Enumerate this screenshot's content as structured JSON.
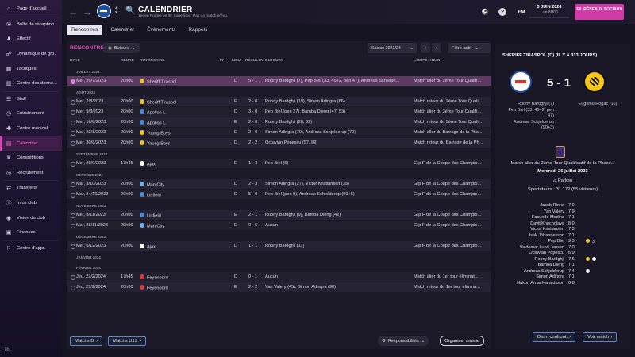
{
  "sidebar": {
    "items": [
      {
        "icon": "home-icon",
        "glyph": "⌂",
        "label": "Page d'accueil"
      },
      {
        "icon": "inbox-icon",
        "glyph": "✉",
        "label": "Boîte de réception"
      },
      {
        "icon": "squad-icon",
        "glyph": "♟",
        "label": "Effectif"
      },
      {
        "icon": "dynamics-icon",
        "glyph": "☍",
        "label": "Dynamique de grp."
      },
      {
        "icon": "tactics-icon",
        "glyph": "▦",
        "label": "Tactiques"
      },
      {
        "icon": "data-icon",
        "glyph": "▥",
        "label": "Centre des donné..."
      },
      {
        "icon": "staff-icon",
        "glyph": "☰",
        "label": "Staff"
      },
      {
        "icon": "training-icon",
        "glyph": "◷",
        "label": "Entraînement"
      },
      {
        "icon": "medical-icon",
        "glyph": "✚",
        "label": "Centre médical"
      },
      {
        "icon": "calendar-icon",
        "glyph": "▤",
        "label": "Calendrier"
      },
      {
        "icon": "competitions-icon",
        "glyph": "♛",
        "label": "Compétitions"
      },
      {
        "icon": "scouting-icon",
        "glyph": "◎",
        "label": "Recrutement"
      },
      {
        "icon": "transfers-icon",
        "glyph": "⇄",
        "label": "Transferts"
      },
      {
        "icon": "club-info-icon",
        "glyph": "ⓘ",
        "label": "Infos club"
      },
      {
        "icon": "club-vision-icon",
        "glyph": "◉",
        "label": "Vision du club"
      },
      {
        "icon": "finances-icon",
        "glyph": "▣",
        "label": "Finances"
      },
      {
        "icon": "dev-centre-icon",
        "glyph": "⚐",
        "label": "Centre d'appr."
      }
    ],
    "active_index": 9,
    "footer": "8b"
  },
  "topbar": {
    "title": "CALENDRIER",
    "subtitle": "1er en Poules de 3F Superliga · Pas de match prévu.",
    "date_line1": "3 JUIN 2024",
    "date_line2": "Lun 8H00",
    "social_label": "FIL RÉSEAUX SOCIAUX",
    "fm_label": "FM",
    "back_glyph": "←",
    "forward_glyph": "→",
    "search_glyph": "🔍",
    "help_glyph": "?",
    "fixture_icon_glyph": "⚽"
  },
  "tabs": [
    "Rencontres",
    "Calendrier",
    "Évènements",
    "Rappels"
  ],
  "main": {
    "section_title": "RENCONTRES",
    "filter_label": "Buteurs",
    "season": "Saison 2023/24",
    "filter_active": "Filtre actif",
    "headers": {
      "date": "DATE",
      "time": "HEURE",
      "opponent": "ADVERSAIRE",
      "tv": "TV",
      "venue": "LIEU",
      "result": "RÉSULTAT",
      "scorers": "BUTEURS",
      "competition": "COMPÉTITION"
    },
    "groups": [
      {
        "month": "JUILLET 2023",
        "rows": [
          {
            "date": "Mer, 26/7/2023",
            "time": "20h00",
            "opponent": "Sheriff Tiraspol",
            "crest": "#e8c531",
            "venue": "D",
            "result": "5 - 1",
            "scorers": "Roony Bardghji (7), Pep Biel (33, 45+2, pen 47), Andreas Schjelde...",
            "competition": "Match aller du 2ème Tour Qualifi...",
            "selected": true
          }
        ]
      },
      {
        "month": "AOÛT 2023",
        "rows": [
          {
            "date": "Mer, 2/8/2023",
            "time": "20h00",
            "opponent": "Sheriff Tiraspol",
            "crest": "#e8c531",
            "venue": "E",
            "result": "2 - 0",
            "scorers": "Roony Bardghji (19), Simon Adingra (66)",
            "competition": "Match retour du 2ème Tour Quali..."
          },
          {
            "date": "Mer, 9/8/2023",
            "time": "20h00",
            "opponent": "Apollon L.",
            "crest": "#4a8ad8",
            "venue": "D",
            "result": "3 - 0",
            "scorers": "Pep Biel (pen 27), Bamba Dieng (47, 53)",
            "competition": "Match aller du 3ème Tour Qualifi..."
          },
          {
            "date": "Mer, 16/8/2023",
            "time": "20h00",
            "opponent": "Apollon L.",
            "crest": "#4a8ad8",
            "venue": "E",
            "result": "2 - 0",
            "scorers": "Roony Bardghji (20, 62)",
            "competition": "Match retour du 3ème Tour Quali..."
          },
          {
            "date": "Mar, 22/8/2023",
            "time": "20h00",
            "opponent": "Young Boys",
            "crest": "#e8c531",
            "venue": "E",
            "result": "2 - 0",
            "scorers": "Simon Adingra (70), Andreas Schjelderup (70)",
            "competition": "Match aller du Barrage de la Pha..."
          },
          {
            "date": "Mer, 30/8/2023",
            "time": "20h00",
            "opponent": "Young Boys",
            "crest": "#e8c531",
            "venue": "D",
            "result": "2 - 2",
            "scorers": "Octavian Popescu (57, 89)",
            "competition": "Match retour du Barrage de la Ph..."
          }
        ]
      },
      {
        "month": "SEPTEMBRE 2023",
        "rows": [
          {
            "date": "Mer, 20/9/2023",
            "time": "17h45",
            "opponent": "Ajax",
            "crest": "#ffffff",
            "venue": "E",
            "result": "1 - 3",
            "scorers": "Pep Biel (6)",
            "competition": "Grp F de la Coupe des Champio..."
          }
        ]
      },
      {
        "month": "OCTOBRE 2023",
        "rows": [
          {
            "date": "Mar, 3/10/2023",
            "time": "20h00",
            "opponent": "Man City",
            "crest": "#6cb4ee",
            "venue": "D",
            "result": "2 - 3",
            "scorers": "Simon Adingra (27), Victor Kristiansen (35)",
            "competition": "Grp F de la Coupe des Champio..."
          },
          {
            "date": "Mar, 24/10/2023",
            "time": "20h00",
            "opponent": "Linfield",
            "crest": "#4a8ad8",
            "venue": "D",
            "result": "5 - 0",
            "scorers": "Pep Biel (pen 9), Andreas Schjelderup (90+6)",
            "competition": "Grp F de la Coupe des Champio..."
          }
        ]
      },
      {
        "month": "NOVEMBRE 2023",
        "rows": [
          {
            "date": "Mer, 8/11/2023",
            "time": "20h00",
            "opponent": "Linfield",
            "crest": "#4a8ad8",
            "venue": "E",
            "result": "2 - 1",
            "scorers": "Roony Bardghji (9), Bamba Dieng (42)",
            "competition": "Grp F de la Coupe des Champio..."
          },
          {
            "date": "Mar, 28/11/2023",
            "time": "20h00",
            "opponent": "Man City",
            "crest": "#6cb4ee",
            "venue": "E",
            "result": "0 - 5",
            "scorers": "Aucun",
            "competition": "Grp F de la Coupe des Champio..."
          }
        ]
      },
      {
        "month": "DÉCEMBRE 2023",
        "rows": [
          {
            "date": "Mer, 6/12/2023",
            "time": "20h00",
            "opponent": "Ajax",
            "crest": "#ffffff",
            "venue": "D",
            "result": "1 - 1",
            "scorers": "Roony Bardghji (11)",
            "competition": "Grp F de la Coupe des Champio..."
          }
        ]
      },
      {
        "month": "JANVIER 2024",
        "rows": []
      },
      {
        "month": "FÉVRIER 2024",
        "rows": [
          {
            "date": "Jeu, 22/2/2024",
            "time": "17h45",
            "opponent": "Feyenoord",
            "crest": "#e03a3a",
            "venue": "D",
            "result": "0 - 1",
            "scorers": "Aucun",
            "competition": "Match aller du 1er tour éliminat..."
          },
          {
            "date": "Jeu, 29/2/2024",
            "time": "20h00",
            "opponent": "Feyenoord",
            "crest": "#e03a3a",
            "venue": "E",
            "result": "2 - 2",
            "scorers": "Yan Valery (45), Simon Adingra (90)",
            "competition": "Match retour du 1er tour élimina..."
          }
        ]
      }
    ],
    "footer": {
      "matches_b": "Matchs B",
      "matches_u19": "Matchs U19",
      "responsibilities": "Responsabilités",
      "organise_friendly": "Organiser amical"
    }
  },
  "match_panel": {
    "title": "SHERIFF TIRASPOL (D) (IL Y A 313 JOURS)",
    "score": "5 - 1",
    "home_scorers": [
      "Roony Bardghji (7)",
      "Pep Biel (33, 45+2, pen",
      "47)",
      "Andreas Schjelderup",
      "(90+3)"
    ],
    "away_scorers": [
      "Eugeniu Rogac (16)"
    ],
    "competition": "Match aller du 2ème Tour Qualificatif de la Phase...",
    "date": "Mercredi 26 juillet 2023",
    "stadium": "Parken",
    "spectators": "Spectateurs : 31 172 (55 visiteurs)",
    "players": [
      {
        "name": "Jacob Rinne",
        "rating": "7,0",
        "events": ""
      },
      {
        "name": "Yan Valery",
        "rating": "7,9",
        "events": ""
      },
      {
        "name": "Facundo Medina",
        "rating": "7,1",
        "events": ""
      },
      {
        "name": "Davit Khocholava",
        "rating": "8,0",
        "events": ""
      },
      {
        "name": "Victor Kristiansen",
        "rating": "7,3",
        "events": ""
      },
      {
        "name": "Isak Jóhannesson",
        "rating": "7,1",
        "events": ""
      },
      {
        "name": "Pep Biel",
        "rating": "9,3",
        "events": "3"
      },
      {
        "name": "Valdemar Lund Jensen",
        "rating": "7,0",
        "events": ""
      },
      {
        "name": "Octavian Popescu",
        "rating": "6,9",
        "events": ""
      },
      {
        "name": "Roony Bardghji",
        "rating": "7,6",
        "events": ""
      },
      {
        "name": "Bamba Dieng",
        "rating": "7,1",
        "events": ""
      },
      {
        "name": "Andreas Schjelderup",
        "rating": "7,4",
        "events": ""
      },
      {
        "name": "Simon Adingra",
        "rating": "7,1",
        "events": ""
      },
      {
        "name": "Håkon Arnar Haraldsson",
        "rating": "6,8",
        "events": ""
      }
    ],
    "btn_compare": "Dem. confront.",
    "btn_view_match": "Voir match"
  },
  "colors": {
    "accent": "#d23aa8",
    "selected_row": "#5c3a62",
    "panel": "#1c1a28"
  }
}
